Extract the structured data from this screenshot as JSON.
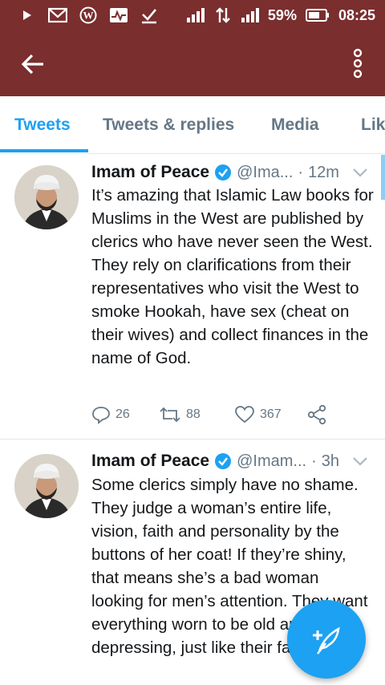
{
  "status_bar": {
    "battery": "59%",
    "time": "08:25",
    "icons": [
      "play-icon",
      "gmail-icon",
      "wordpress-icon",
      "pulse-icon",
      "checkmark-icon",
      "signal-icon",
      "data-transfer-icon",
      "signal-icon",
      "battery-icon"
    ]
  },
  "colors": {
    "app_bar": "#7a2e2e",
    "accent": "#1da1f2",
    "secondary_text": "#657786"
  },
  "tabs": [
    {
      "label": "Tweets",
      "active": true
    },
    {
      "label": "Tweets & replies",
      "active": false
    },
    {
      "label": "Media",
      "active": false
    },
    {
      "label": "Lik",
      "active": false
    }
  ],
  "tweets": [
    {
      "name": "Imam of Peace",
      "handle": "@Ima...",
      "sep": "·",
      "time": "12m",
      "text": "It’s amazing that Islamic Law books for Muslims in the West are published by clerics who have never seen the West. They rely on clarifications from their representatives who visit the West to smoke Hookah, have sex (cheat on their wives) and collect finances in the name of God.",
      "replies": "26",
      "retweets": "88",
      "likes": "367"
    },
    {
      "name": "Imam of Peace",
      "handle": "@Imam...",
      "sep": "·",
      "time": "3h",
      "text": "Some clerics simply have no shame. They judge a woman’s entire life, vision, faith and personality by the buttons of her coat! If they’re shiny, that means she’s a bad woman looking for men’s attention. They want everything worn to be old and depressing, just like their faces!!!"
    }
  ]
}
